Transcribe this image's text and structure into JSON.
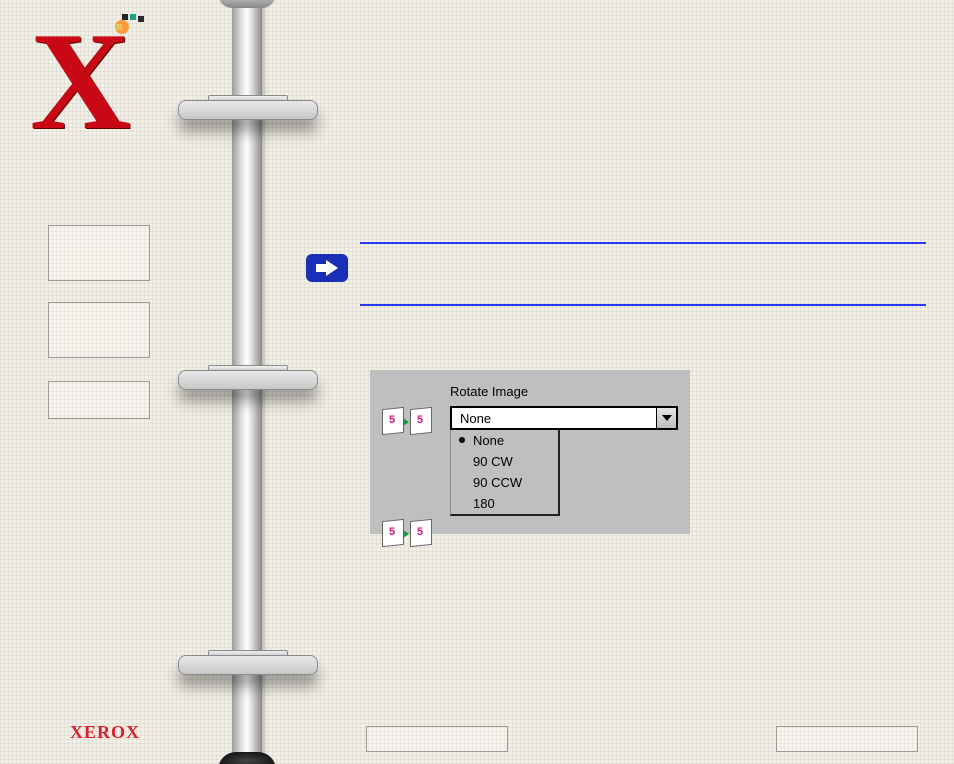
{
  "logo": {
    "footer_text": "XEROX"
  },
  "rotate_panel": {
    "label": "Rotate Image",
    "icon_digit_left": "5",
    "icon_digit_right": "5",
    "selected": "None",
    "options": [
      "None",
      "90 CW",
      "90 CCW",
      "180"
    ]
  }
}
